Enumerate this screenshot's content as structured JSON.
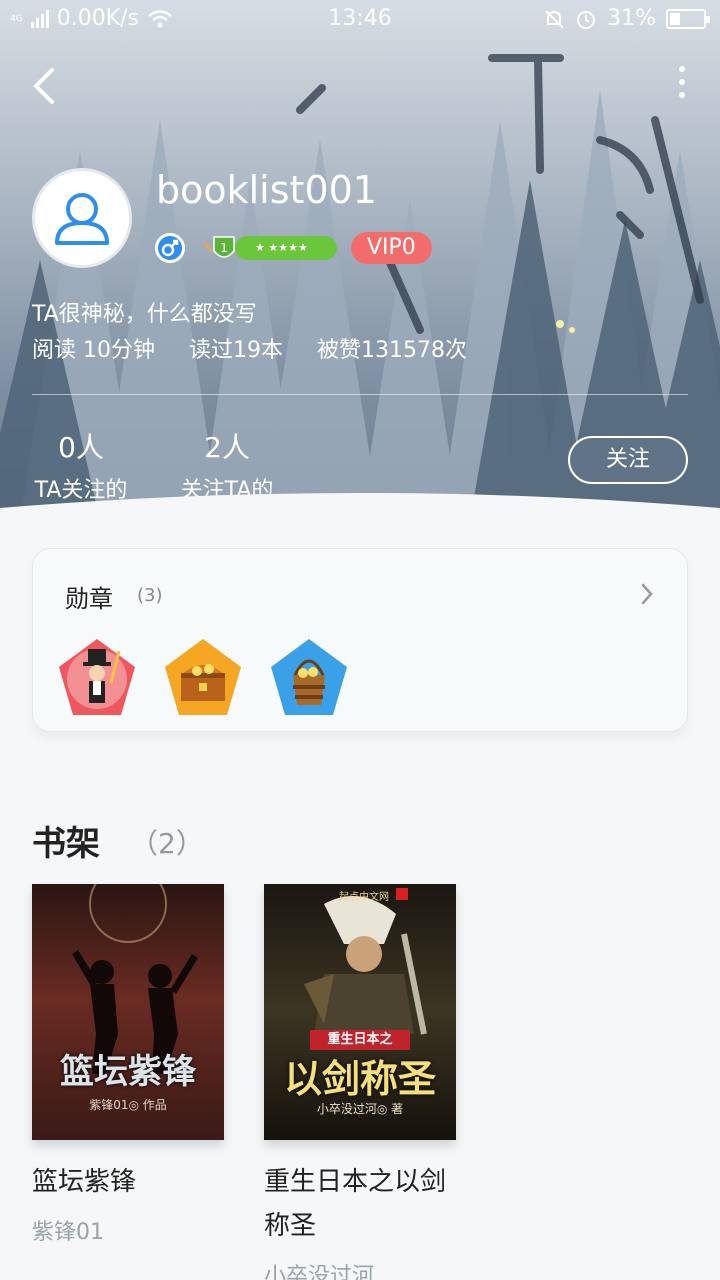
{
  "status_bar": {
    "network": "4G",
    "speed": "0.00K/s",
    "time": "13:46",
    "battery": "31%",
    "battery_level": 0.31
  },
  "profile": {
    "username": "booklist001",
    "level": "1",
    "vip": "VIP0",
    "bio": "TA很神秘，什么都没写",
    "reading_time": "阅读 10分钟",
    "books_read": "读过19本",
    "likes": "被赞131578次",
    "following_count": "0人",
    "following_label": "TA关注的",
    "followers_count": "2人",
    "followers_label": "关注TA的",
    "follow_button": "关注"
  },
  "medals": {
    "title": "勋章",
    "count": "(3)",
    "items": [
      {
        "icon": "magician-medal-icon",
        "color": "#f0565e"
      },
      {
        "icon": "treasure-chest-medal-icon",
        "color": "#f5a623"
      },
      {
        "icon": "gold-bucket-medal-icon",
        "color": "#3aa0e8"
      }
    ]
  },
  "shelf": {
    "title": "书架",
    "count": "（2）",
    "books": [
      {
        "title": "篮坛紫锋",
        "author": "紫锋01",
        "cover_title": "篮坛紫锋",
        "cover_subtitle": "紫锋01◎ 作品"
      },
      {
        "title": "重生日本之以剑称圣",
        "author": "小卒没过河",
        "cover_banner": "重生日本之",
        "cover_title": "以剑称圣",
        "cover_subtitle": "小卒没过河◎ 著",
        "cover_brand": "起点中文网"
      }
    ]
  },
  "colors": {
    "vip": "#f36c6c",
    "level": "#6cc63c",
    "gender": "#2e8ef0",
    "avatar": "#2e8ef0"
  }
}
